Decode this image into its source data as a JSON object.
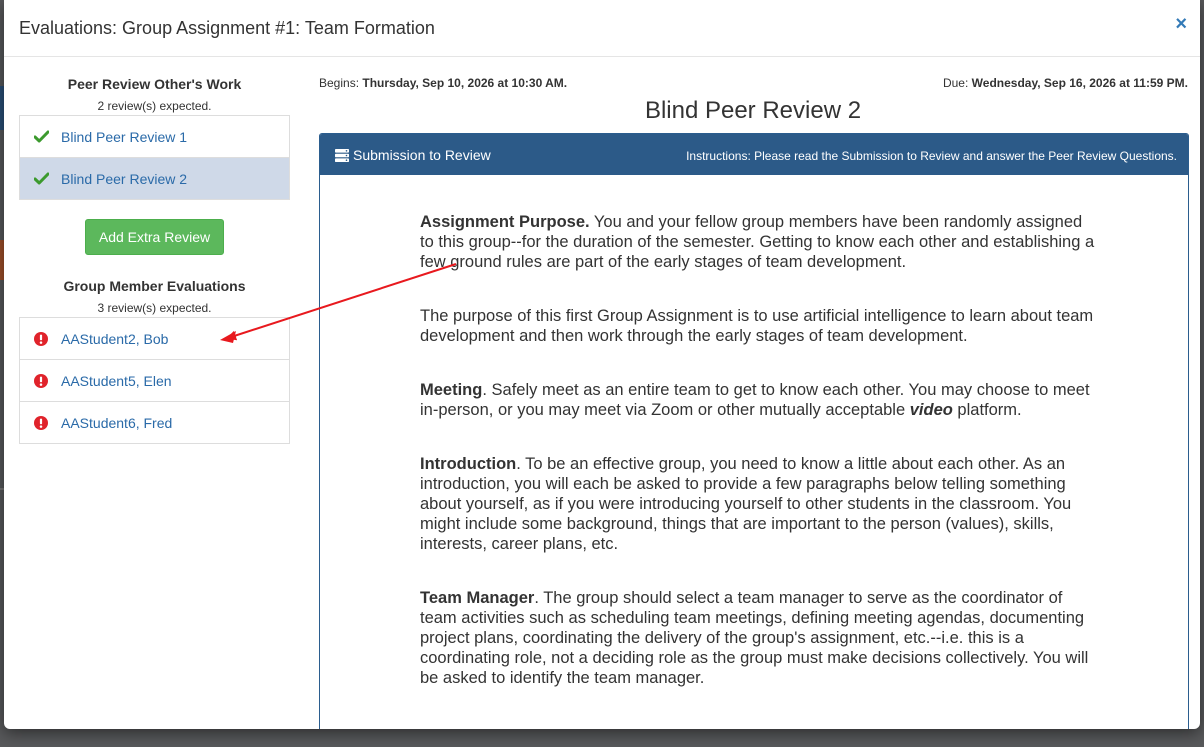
{
  "modal": {
    "title": "Evaluations: Group Assignment #1: Team Formation",
    "close_label": "×"
  },
  "peer_review": {
    "title": "Peer Review Other's Work",
    "subtitle": "2 review(s) expected.",
    "items": [
      {
        "label": "Blind Peer Review 1",
        "status": "complete",
        "icon": "check-icon"
      },
      {
        "label": "Blind Peer Review 2",
        "status": "complete",
        "icon": "check-icon",
        "active": true
      }
    ],
    "add_button": "Add Extra Review"
  },
  "group_eval": {
    "title": "Group Member Evaluations",
    "subtitle": "3 review(s) expected.",
    "items": [
      {
        "label": "AAStudent2, Bob",
        "status": "incomplete",
        "icon": "exclamation-circle-icon"
      },
      {
        "label": "AAStudent5, Elen",
        "status": "incomplete",
        "icon": "exclamation-circle-icon"
      },
      {
        "label": "AAStudent6, Fred",
        "status": "incomplete",
        "icon": "exclamation-circle-icon"
      }
    ]
  },
  "dates": {
    "begins_label": "Begins:",
    "begins_value": "Thursday, Sep 10, 2026 at 10:30 AM.",
    "due_label": "Due:",
    "due_value": "Wednesday, Sep 16, 2026 at 11:59 PM."
  },
  "review": {
    "title": "Blind Peer Review 2",
    "panel_title": "Submission to Review",
    "panel_icon": "server-icon",
    "instructions": "Instructions: Please read the Submission to Review and answer the Peer Review Questions.",
    "paragraphs": [
      {
        "lead": "Assignment Purpose.",
        "text": " You and your fellow group members have been randomly assigned to this group--for the duration of the semester. Getting to know each other and establishing a few ground rules are part of the early stages of team development."
      },
      {
        "lead": "",
        "text": "The purpose of this first Group Assignment is to use artificial intelligence to learn about team development and then work through the early stages of team development."
      },
      {
        "lead": "Meeting",
        "text": ". Safely meet as an entire team to get to know each other. You may choose to meet in-person, or you may meet via Zoom or other mutually acceptable ",
        "emph": "video",
        "tail": " platform."
      },
      {
        "lead": "Introduction",
        "text": ". To be an effective group, you need to know a little about each other. As an introduction, you will each be asked to provide a few paragraphs below telling something about yourself, as if you were introducing yourself to other students in the classroom. You might include some background, things that are important to the person (values), skills, interests, career plans, etc."
      },
      {
        "lead": "Team Manager",
        "text": ". The group should select a team manager to serve as the coordinator of team activities such as scheduling team meetings, defining meeting agendas, documenting project plans, coordinating the delivery of the group's assignment, etc.--i.e. this is a coordinating role, not a deciding role as the group must make decisions collectively. You will be asked to identify the team manager."
      }
    ]
  },
  "colors": {
    "link": "#2a6aa8",
    "success": "#3c9a2e",
    "danger": "#e0232b",
    "panel_header": "#2c5a88",
    "add_button": "#5cb85c",
    "annotation_arrow": "#e8191e"
  }
}
